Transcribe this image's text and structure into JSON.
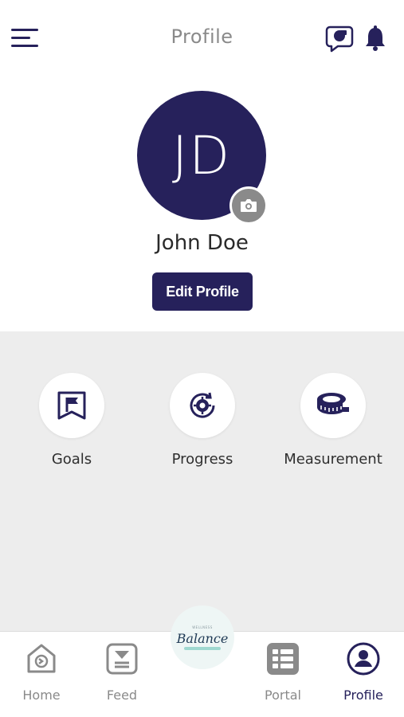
{
  "header": {
    "title": "Profile",
    "menu_icon": "hamburger-menu-icon",
    "chat_icon": "chat-bubble-icon",
    "notification_icon": "bell-icon"
  },
  "profile": {
    "initials": "JD",
    "name": "John Doe",
    "edit_label": "Edit Profile",
    "camera_icon": "camera-icon"
  },
  "quick_actions": [
    {
      "label": "Goals",
      "icon": "flag-icon"
    },
    {
      "label": "Progress",
      "icon": "progress-cycle-icon"
    },
    {
      "label": "Measurement",
      "icon": "measuring-tape-icon"
    }
  ],
  "bottom_nav": {
    "items": [
      {
        "label": "Home",
        "icon": "home-icon",
        "active": false
      },
      {
        "label": "Feed",
        "icon": "feed-icon",
        "active": false
      },
      {
        "label": "Portal",
        "icon": "portal-icon",
        "active": false
      },
      {
        "label": "Profile",
        "icon": "user-icon",
        "active": true
      }
    ],
    "center_logo": {
      "text": "Balance",
      "small_text": "WELLNESS"
    }
  },
  "colors": {
    "primary": "#26215b",
    "gray": "#8a8a8a",
    "content_bg": "#ededed"
  }
}
